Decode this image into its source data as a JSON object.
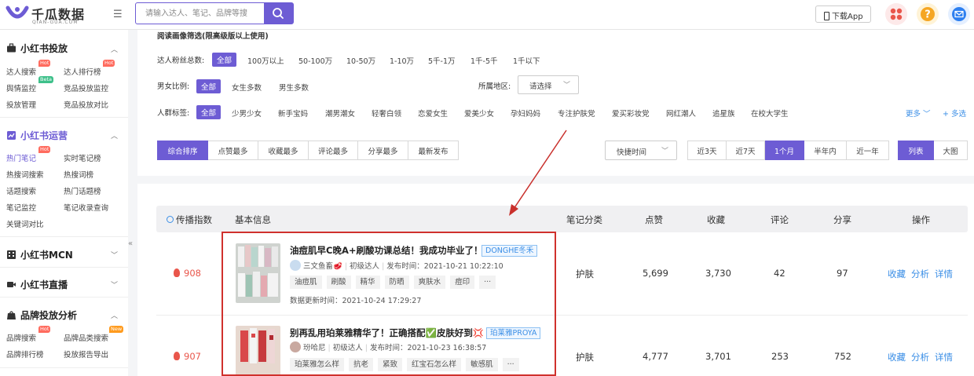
{
  "brand": {
    "name": "千瓜数据",
    "domain": "QIAN-GUA.COM",
    "accent": "#6d5cd4"
  },
  "search": {
    "placeholder": "请输入达人、笔记、品牌等搜"
  },
  "header": {
    "download_label": "下载App"
  },
  "sidebar": {
    "sections": [
      {
        "title": "小红书投放",
        "items": [
          {
            "label": "达人搜索",
            "badge": "Hot"
          },
          {
            "label": "达人排行榜",
            "badge": "Hot"
          },
          {
            "label": "舆情监控",
            "badge": "Beta"
          },
          {
            "label": "竞品投放监控",
            "badge": ""
          },
          {
            "label": "投放管理",
            "badge": ""
          },
          {
            "label": "竞品投放对比",
            "badge": ""
          }
        ]
      },
      {
        "title": "小红书运营",
        "items": [
          {
            "label": "热门笔记",
            "badge": "Hot"
          },
          {
            "label": "实时笔记榜",
            "badge": ""
          },
          {
            "label": "热搜词搜索",
            "badge": ""
          },
          {
            "label": "热搜词榜",
            "badge": ""
          },
          {
            "label": "话题搜索",
            "badge": ""
          },
          {
            "label": "热门话题榜",
            "badge": ""
          },
          {
            "label": "笔记监控",
            "badge": ""
          },
          {
            "label": "笔记收录查询",
            "badge": ""
          },
          {
            "label": "关键词对比",
            "badge": ""
          }
        ]
      },
      {
        "title": "小红书MCN",
        "items": []
      },
      {
        "title": "小红书直播",
        "items": []
      },
      {
        "title": "品牌投放分析",
        "items": [
          {
            "label": "品牌搜索",
            "badge": "Hot"
          },
          {
            "label": "品牌品类搜索",
            "badge": "New"
          },
          {
            "label": "品牌排行榜",
            "badge": ""
          },
          {
            "label": "投放报告导出",
            "badge": ""
          }
        ]
      }
    ]
  },
  "filters": {
    "portrait_note": "阅读画像筛选(限高级版以上使用)",
    "fans_label": "达人粉丝总数:",
    "fans_options": [
      "全部",
      "100万以上",
      "50-100万",
      "10-50万",
      "1-10万",
      "5千-1万",
      "1千-5千",
      "1千以下"
    ],
    "gender_label": "男女比例:",
    "gender_options": [
      "全部",
      "女生多数",
      "男生多数"
    ],
    "region_label": "所属地区:",
    "region_value": "请选择",
    "crowd_label": "人群标签:",
    "crowd_options": [
      "全部",
      "少男少女",
      "新手宝妈",
      "潮男潮女",
      "轻奢白领",
      "恋爱女生",
      "爱美少女",
      "孕妇妈妈",
      "专注护肤党",
      "爱买彩妆党",
      "网红潮人",
      "追星族",
      "在校大学生"
    ],
    "more_label": "更多",
    "multi_label": "+ 多选"
  },
  "sort_tabs": [
    "综合排序",
    "点赞最多",
    "收藏最多",
    "评论最多",
    "分享最多",
    "最新发布"
  ],
  "time_dropdown": "快捷时间",
  "ranges": [
    "近3天",
    "近7天",
    "1个月",
    "半年内",
    "近一年"
  ],
  "views": [
    "列表",
    "大图"
  ],
  "table": {
    "headers": [
      "传播指数",
      "基本信息",
      "笔记分类",
      "点赞",
      "收藏",
      "评论",
      "分享",
      "操作"
    ],
    "actions": [
      "收藏",
      "分析",
      "详情"
    ],
    "rows": [
      {
        "index": "908",
        "title": "油痘肌早C晚A+刷酸功课总结！我成功毕业了！",
        "brand": "DONGHE冬禾",
        "author": "三文鱼畜🥩",
        "level": "初级达人",
        "published": "发布时间：2021-10-21 10:22:10",
        "tags": [
          "油痘肌",
          "刷酸",
          "精华",
          "防晒",
          "爽肤水",
          "痘印",
          "···"
        ],
        "updated": "数据更新时间：2021-10-24 17:29:27",
        "category": "护肤",
        "likes": "5,699",
        "collects": "3,730",
        "comments": "42",
        "shares": "97"
      },
      {
        "index": "907",
        "title": "别再乱用珀莱雅精华了！正确搭配✅皮肤好到💢",
        "brand": "珀莱雅PROYA",
        "author": "玢哈尼",
        "level": "初级达人",
        "published": "发布时间：2021-10-23 16:38:57",
        "tags": [
          "珀莱雅怎么样",
          "抗老",
          "紧致",
          "红宝石怎么样",
          "敏感肌",
          "···"
        ],
        "updated": "",
        "category": "护肤",
        "likes": "4,777",
        "collects": "3,701",
        "comments": "253",
        "shares": "752"
      }
    ]
  }
}
